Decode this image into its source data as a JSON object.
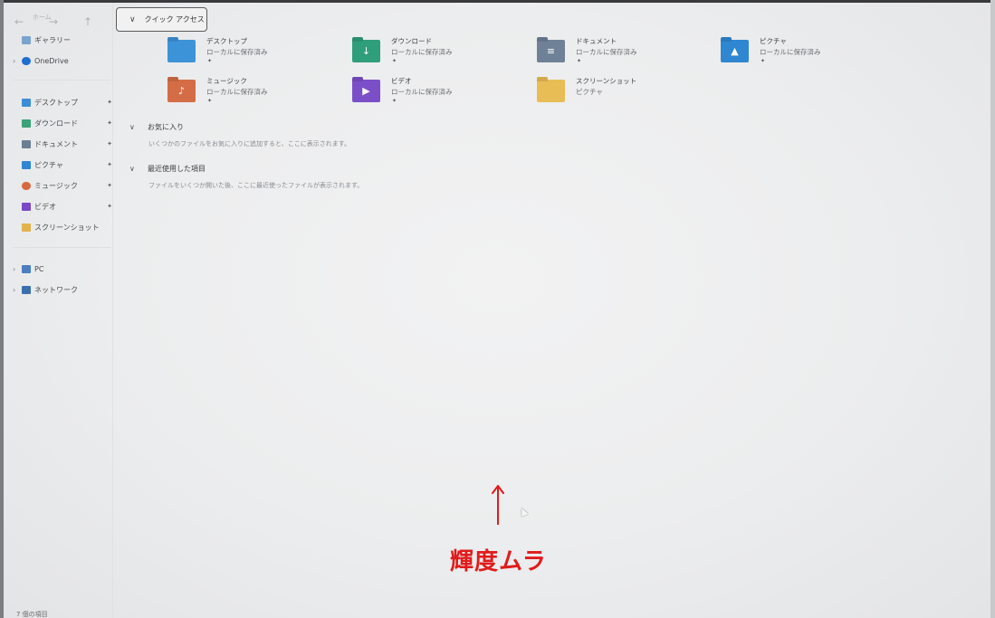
{
  "toolbar": {
    "back": "←",
    "forward": "→",
    "up": "↑",
    "home": "ホーム"
  },
  "sidebar": {
    "gallery": "ギャラリー",
    "onedrive": "OneDrive",
    "pinned": [
      {
        "label": "デスクトップ",
        "icon": "desktop-icon",
        "color": "#3b8ed6"
      },
      {
        "label": "ダウンロード",
        "icon": "download-icon",
        "color": "#3aa37a"
      },
      {
        "label": "ドキュメント",
        "icon": "document-icon",
        "color": "#6c7e93"
      },
      {
        "label": "ピクチャ",
        "icon": "pictures-icon",
        "color": "#2f86d1"
      },
      {
        "label": "ミュージック",
        "icon": "music-icon",
        "color": "#d86a3d"
      },
      {
        "label": "ビデオ",
        "icon": "video-icon",
        "color": "#7c49c9"
      },
      {
        "label": "スクリーンショット",
        "icon": "folder-icon",
        "color": "#e2b24a"
      }
    ],
    "pc": "PC",
    "network": "ネットワーク"
  },
  "main": {
    "quick_access": "クイック アクセス",
    "folders": [
      {
        "name": "デスクトップ",
        "sub": "ローカルに保存済み",
        "color": "#3d93d8",
        "glyph": "",
        "pinned": true
      },
      {
        "name": "ダウンロード",
        "sub": "ローカルに保存済み",
        "color": "#2f9e7b",
        "glyph": "↓",
        "pinned": true
      },
      {
        "name": "ドキュメント",
        "sub": "ローカルに保存済み",
        "color": "#6f8197",
        "glyph": "≡",
        "pinned": true
      },
      {
        "name": "ピクチャ",
        "sub": "ローカルに保存済み",
        "color": "#2f87d2",
        "glyph": "▲",
        "pinned": true
      },
      {
        "name": "ミュージック",
        "sub": "ローカルに保存済み",
        "color": "#d46d46",
        "glyph": "♪",
        "pinned": true
      },
      {
        "name": "ビデオ",
        "sub": "ローカルに保存済み",
        "color": "#7b4fc8",
        "glyph": "▶",
        "pinned": true
      },
      {
        "name": "スクリーンショット",
        "sub": "ピクチャ",
        "color": "#e9bd56",
        "glyph": "",
        "pinned": false
      }
    ],
    "favorites": {
      "title": "お気に入り",
      "hint": "いくつかのファイルをお気に入りに追加すると、ここに表示されます。"
    },
    "recent": {
      "title": "最近使用した項目",
      "hint": "ファイルをいくつか開いた後、ここに最近使ったファイルが表示されます。"
    }
  },
  "status": "7 個の項目",
  "annotation": {
    "text": "輝度ムラ",
    "color": "#e11b1b"
  }
}
